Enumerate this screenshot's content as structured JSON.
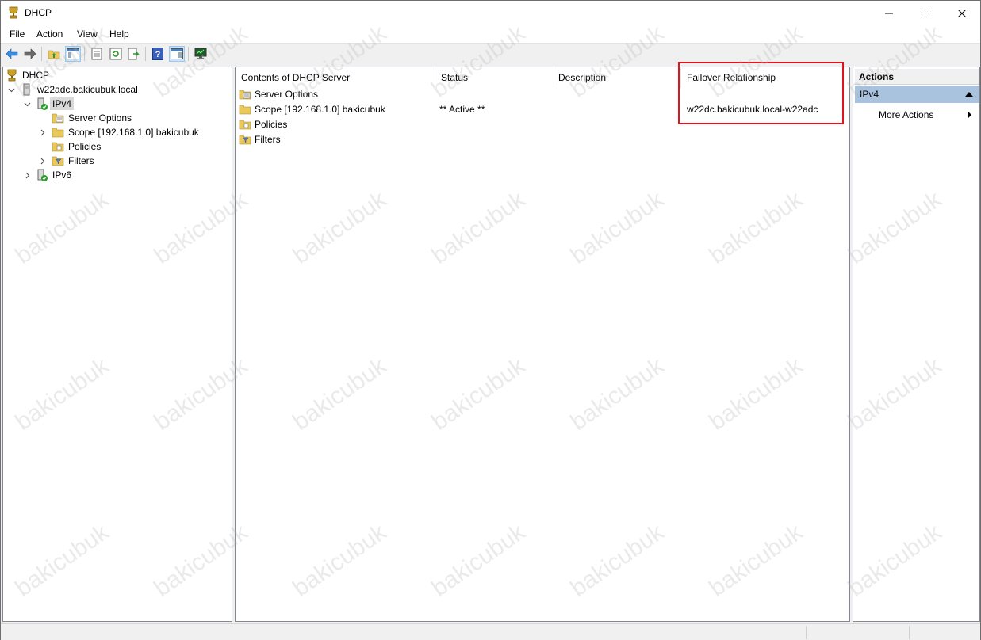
{
  "window": {
    "title": "DHCP",
    "controls": {
      "minimize": "minimize-icon",
      "maximize": "maximize-icon",
      "close": "close-icon"
    }
  },
  "menu": {
    "items": [
      "File",
      "Action",
      "View",
      "Help"
    ]
  },
  "toolbar": {
    "buttons": [
      "back-arrow-icon",
      "forward-arrow-icon",
      "up-folder-icon",
      "show-hide-tree-icon",
      "properties-icon",
      "refresh-icon",
      "export-list-icon",
      "help-icon",
      "show-action-pane-icon",
      "monitor-icon"
    ]
  },
  "tree": {
    "root": "DHCP",
    "server": "w22adc.bakicubuk.local",
    "ipv4": "IPv4",
    "server_options": "Server Options",
    "scope": "Scope [192.168.1.0] bakicubuk",
    "policies": "Policies",
    "filters": "Filters",
    "ipv6": "IPv6"
  },
  "content": {
    "columns": [
      "Contents of DHCP Server",
      "Status",
      "Description",
      "Failover Relationship"
    ],
    "rows": [
      {
        "name": "Server Options",
        "status": "",
        "description": "",
        "failover": ""
      },
      {
        "name": "Scope [192.168.1.0] bakicubuk",
        "status": "** Active **",
        "description": "",
        "failover": "w22dc.bakicubuk.local-w22adc"
      },
      {
        "name": "Policies",
        "status": "",
        "description": "",
        "failover": ""
      },
      {
        "name": "Filters",
        "status": "",
        "description": "",
        "failover": ""
      }
    ]
  },
  "actions": {
    "header": "Actions",
    "section": "IPv4",
    "more_actions": "More Actions"
  },
  "watermark": "bakicubuk",
  "colors": {
    "selection_bg": "#d9d9d9",
    "actions_section_bg": "#a9c2de",
    "highlight_border": "#e0141e"
  }
}
